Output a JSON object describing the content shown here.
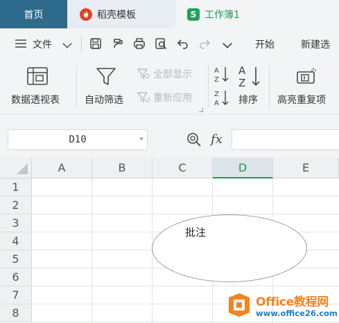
{
  "tabs": {
    "home": "首页",
    "daoke": "稻壳模板",
    "book": "工作簿1",
    "book_icon": "S"
  },
  "menu": {
    "file": "文件",
    "start": "开始",
    "new_tab": "新建选"
  },
  "ribbon": {
    "pivot": "数据透视表",
    "autofilter": "自动筛选",
    "show_all": "全部显示",
    "reapply": "重新应用",
    "sort": "排序",
    "highlight_dup": "高亮重复项"
  },
  "formula_bar": {
    "name_box": "D10",
    "fx": "fx",
    "formula": ""
  },
  "sheet": {
    "columns": [
      "A",
      "B",
      "C",
      "D",
      "E"
    ],
    "selected_column": "D",
    "rows": [
      "1",
      "2",
      "3",
      "4",
      "5",
      "6",
      "7",
      "8"
    ],
    "comment_text": "批注"
  },
  "watermark": {
    "title": "Office教程网",
    "url": "www.office26.com"
  },
  "colors": {
    "tab_bar": "#2f6c8f",
    "accent_green": "#1e9b50",
    "watermark_orange": "#f4841f",
    "watermark_blue": "#1f7fc6"
  }
}
